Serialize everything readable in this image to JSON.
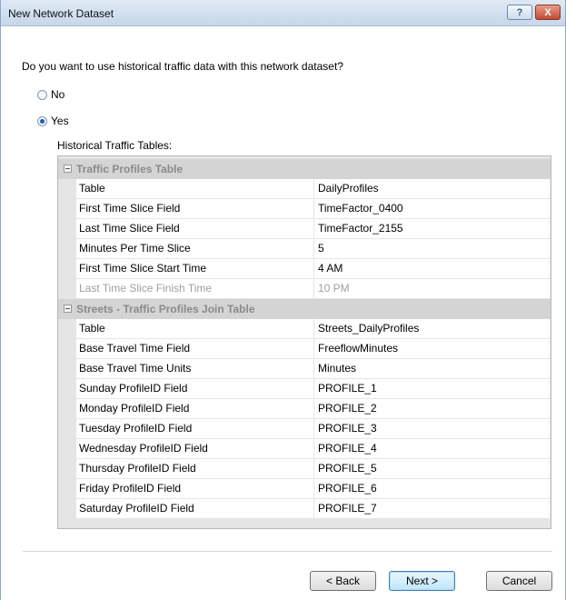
{
  "window": {
    "title": "New Network Dataset"
  },
  "titlebar": {
    "help_label": "?",
    "close_label": "X"
  },
  "question": "Do you want to use historical traffic data with this network dataset?",
  "options": [
    {
      "label": "No",
      "selected": false
    },
    {
      "label": "Yes",
      "selected": true
    }
  ],
  "tables_label": "Historical Traffic Tables:",
  "categories": [
    {
      "name": "Traffic Profiles Table",
      "rows": [
        {
          "name": "Table",
          "value": "DailyProfiles",
          "disabled": false
        },
        {
          "name": "First Time Slice Field",
          "value": "TimeFactor_0400",
          "disabled": false
        },
        {
          "name": "Last Time Slice Field",
          "value": "TimeFactor_2155",
          "disabled": false
        },
        {
          "name": "Minutes Per Time Slice",
          "value": "5",
          "disabled": false
        },
        {
          "name": "First Time Slice Start Time",
          "value": "4 AM",
          "disabled": false
        },
        {
          "name": "Last Time Slice Finish Time",
          "value": "10 PM",
          "disabled": true
        }
      ]
    },
    {
      "name": "Streets - Traffic Profiles  Join Table",
      "rows": [
        {
          "name": "Table",
          "value": "Streets_DailyProfiles",
          "disabled": false
        },
        {
          "name": "Base Travel Time Field",
          "value": "FreeflowMinutes",
          "disabled": false
        },
        {
          "name": "Base Travel Time Units",
          "value": "Minutes",
          "disabled": false
        },
        {
          "name": "Sunday ProfileID Field",
          "value": "PROFILE_1",
          "disabled": false
        },
        {
          "name": "Monday ProfileID Field",
          "value": "PROFILE_2",
          "disabled": false
        },
        {
          "name": "Tuesday ProfileID Field",
          "value": "PROFILE_3",
          "disabled": false
        },
        {
          "name": "Wednesday ProfileID Field",
          "value": "PROFILE_4",
          "disabled": false
        },
        {
          "name": "Thursday ProfileID Field",
          "value": "PROFILE_5",
          "disabled": false
        },
        {
          "name": "Friday ProfileID Field",
          "value": "PROFILE_6",
          "disabled": false
        },
        {
          "name": "Saturday ProfileID Field",
          "value": "PROFILE_7",
          "disabled": false
        }
      ]
    }
  ],
  "buttons": {
    "back": "< Back",
    "next": "Next >",
    "cancel": "Cancel"
  },
  "colors": {
    "category_bg": "#d4d4d4",
    "default_button": "#3c7fb1",
    "radio_dot": "#1e5fb8"
  }
}
